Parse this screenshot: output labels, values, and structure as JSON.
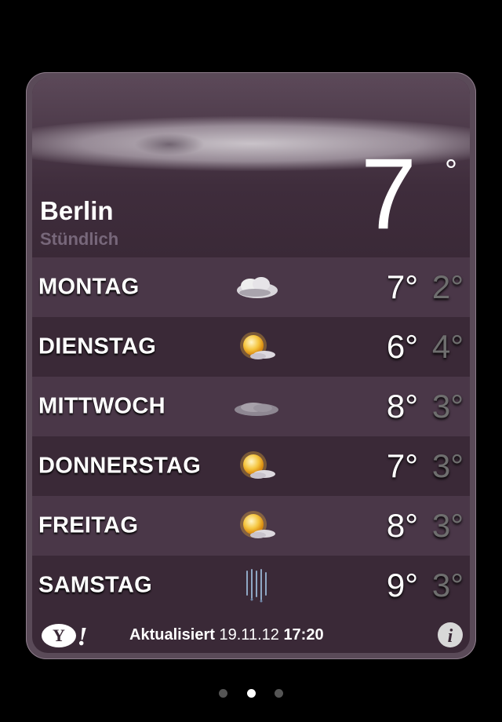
{
  "location": {
    "city": "Berlin",
    "subtitle": "Stündlich",
    "current_temp": "7",
    "degree_symbol": "°",
    "current_condition_icon": "overcast-cloud-icon"
  },
  "forecast": [
    {
      "day": "MONTAG",
      "icon": "partly-cloudy-icon",
      "high": "7°",
      "low": "2°"
    },
    {
      "day": "DIENSTAG",
      "icon": "sun-behind-cloud-icon",
      "high": "6°",
      "low": "4°"
    },
    {
      "day": "MITTWOCH",
      "icon": "cloud-icon",
      "high": "8°",
      "low": "3°"
    },
    {
      "day": "DONNERSTAG",
      "icon": "sun-behind-cloud-icon",
      "high": "7°",
      "low": "3°"
    },
    {
      "day": "FREITAG",
      "icon": "sun-behind-cloud-icon",
      "high": "8°",
      "low": "3°"
    },
    {
      "day": "SAMSTAG",
      "icon": "rain-icon",
      "high": "9°",
      "low": "3°"
    }
  ],
  "footer": {
    "provider_logo": "Y!",
    "updated_label": "Aktualisiert",
    "updated_date": "19.11.12",
    "updated_time": "17:20",
    "info_icon": "i"
  },
  "pager": {
    "count": 3,
    "active_index": 1
  },
  "colors": {
    "card_background": "#3a2937",
    "row_alt_background": "#4a3748",
    "low_temp": "#6e6e6e",
    "subtitle": "#77677a"
  }
}
